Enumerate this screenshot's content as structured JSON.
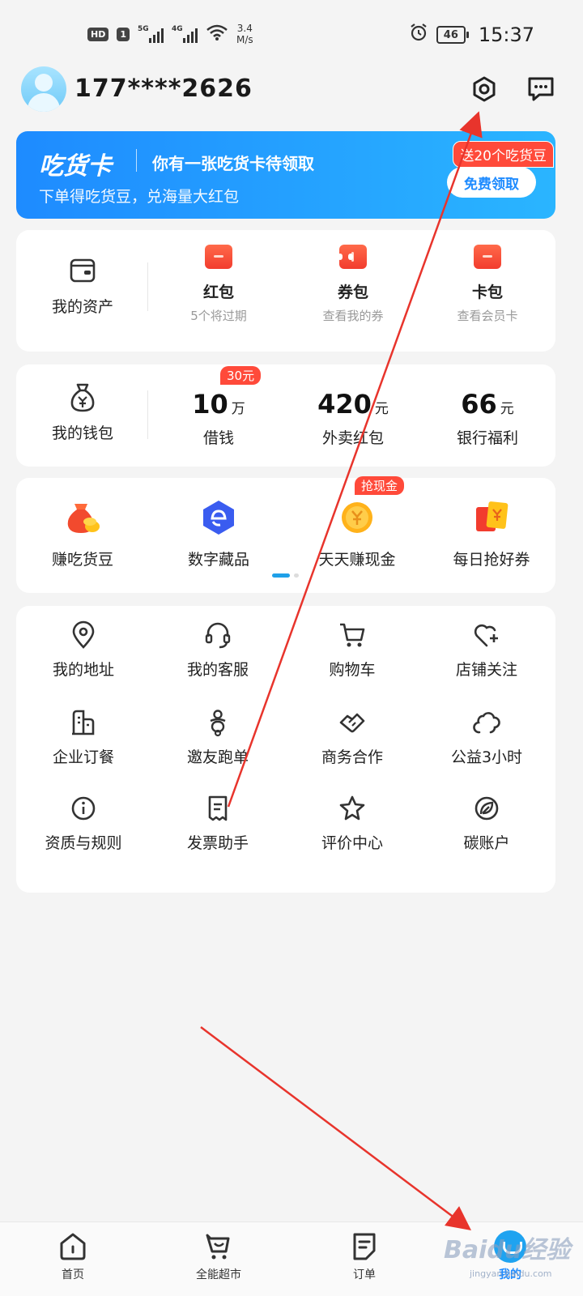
{
  "status_bar": {
    "hd": "HD",
    "sim": "1",
    "net1": "5G",
    "net2": "4G",
    "speed_value": "3.4",
    "speed_unit": "M/s",
    "battery": "46",
    "time": "15:37"
  },
  "header": {
    "phone": "177****2626"
  },
  "banner": {
    "brand": "吃货卡",
    "headline": "你有一张吃货卡待领取",
    "subtitle": "下单得吃货豆，兑海量大红包",
    "gift_tag": "送20个吃货豆",
    "claim_button": "免费领取"
  },
  "assets": {
    "title": "我的资产",
    "items": [
      {
        "label": "红包",
        "sub": "5个将过期"
      },
      {
        "label": "券包",
        "sub": "查看我的券"
      },
      {
        "label": "卡包",
        "sub": "查看会员卡"
      }
    ]
  },
  "wallet": {
    "title": "我的钱包",
    "items": [
      {
        "value": "10",
        "unit": "万",
        "label": "借钱",
        "tag": "30元"
      },
      {
        "value": "420",
        "unit": "元",
        "label": "外卖红包"
      },
      {
        "value": "66",
        "unit": "元",
        "label": "银行福利"
      }
    ]
  },
  "promos": {
    "items": [
      {
        "label": "赚吃货豆"
      },
      {
        "label": "数字藏品"
      },
      {
        "label": "天天赚现金",
        "tag": "抢现金"
      },
      {
        "label": "每日抢好券"
      }
    ]
  },
  "services": {
    "items": [
      {
        "label": "我的地址",
        "icon": "location-icon"
      },
      {
        "label": "我的客服",
        "icon": "headset-icon"
      },
      {
        "label": "购物车",
        "icon": "cart-icon"
      },
      {
        "label": "店铺关注",
        "icon": "heart-plus-icon"
      },
      {
        "label": "企业订餐",
        "icon": "building-icon"
      },
      {
        "label": "邀友跑单",
        "icon": "rider-icon"
      },
      {
        "label": "商务合作",
        "icon": "handshake-icon"
      },
      {
        "label": "公益3小时",
        "icon": "cloud-icon"
      },
      {
        "label": "资质与规则",
        "icon": "info-icon"
      },
      {
        "label": "发票助手",
        "icon": "receipt-icon"
      },
      {
        "label": "评价中心",
        "icon": "star-icon"
      },
      {
        "label": "碳账户",
        "icon": "leaf-icon"
      }
    ]
  },
  "bottom_nav": {
    "items": [
      {
        "label": "首页"
      },
      {
        "label": "全能超市"
      },
      {
        "label": "订单"
      },
      {
        "label": "我的"
      }
    ]
  },
  "watermark": {
    "brand": "Baidu经验",
    "url": "jingyan.baidu.com"
  },
  "colors": {
    "accent": "#1e8bff",
    "promo_red": "#ff4a3a",
    "annotation_red": "#e8342c"
  }
}
